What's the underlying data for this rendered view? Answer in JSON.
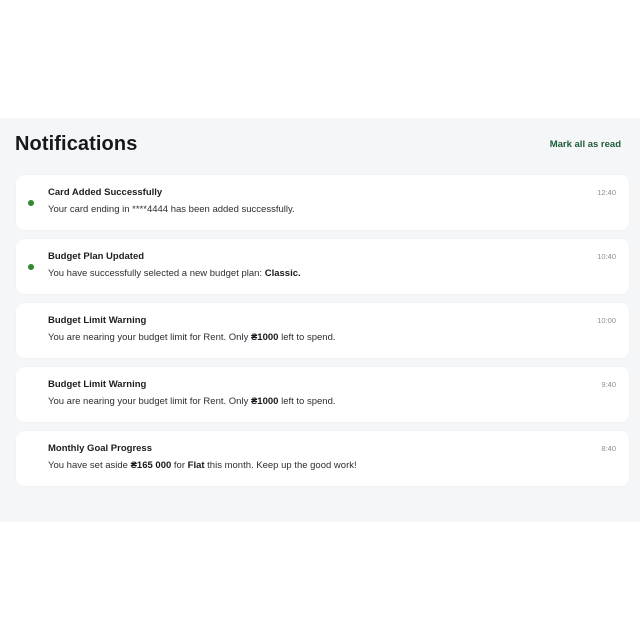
{
  "header": {
    "title": "Notifications",
    "mark_all_label": "Mark all as read"
  },
  "colors": {
    "accent": "#1f5a3c",
    "unread_dot": "#2f8a2f",
    "panel_bg": "#f4f6f7",
    "card_bg": "#ffffff"
  },
  "notifications": [
    {
      "title": "Card Added Successfully",
      "time": "12:40",
      "unread": true,
      "message": [
        {
          "text": "Your card ending in ****4444 has been added successfully.",
          "bold": false
        }
      ]
    },
    {
      "title": "Budget Plan Updated",
      "time": "10:40",
      "unread": true,
      "message": [
        {
          "text": "You have successfully selected a new budget plan: ",
          "bold": false
        },
        {
          "text": "Classic.",
          "bold": true
        }
      ]
    },
    {
      "title": "Budget Limit Warning",
      "time": "10:00",
      "unread": false,
      "message": [
        {
          "text": "You are nearing your budget limit for Rent. Only ",
          "bold": false
        },
        {
          "text": "₴1000",
          "bold": true
        },
        {
          "text": " left to spend.",
          "bold": false
        }
      ]
    },
    {
      "title": "Budget Limit Warning",
      "time": "9:40",
      "unread": false,
      "message": [
        {
          "text": "You are nearing your budget limit for Rent. Only ",
          "bold": false
        },
        {
          "text": "₴1000",
          "bold": true
        },
        {
          "text": " left to spend.",
          "bold": false
        }
      ]
    },
    {
      "title": "Monthly Goal Progress",
      "time": "8:40",
      "unread": false,
      "message": [
        {
          "text": "You have set aside ",
          "bold": false
        },
        {
          "text": "₴165 000",
          "bold": true
        },
        {
          "text": " for ",
          "bold": false
        },
        {
          "text": "Flat",
          "bold": true
        },
        {
          "text": " this month. Keep up the good work!",
          "bold": false
        }
      ]
    }
  ]
}
